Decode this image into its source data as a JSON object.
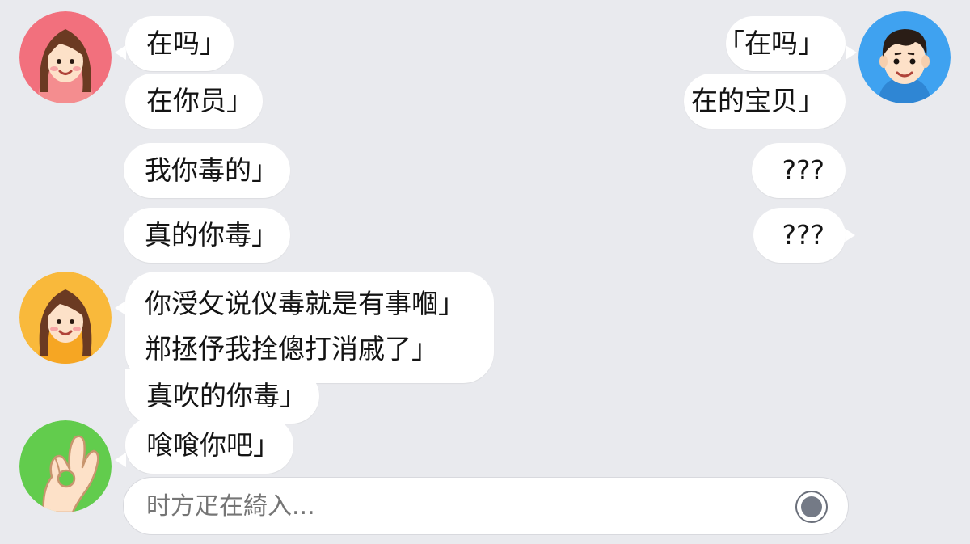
{
  "conversation": {
    "left_top_messages": [
      {
        "text": "在吗」"
      },
      {
        "text": "在你员」"
      },
      {
        "text": "我你毒的」"
      },
      {
        "text": "真的你毒」"
      }
    ],
    "right_messages": [
      {
        "text": "「在吗」"
      },
      {
        "text": "在的宝贝」"
      },
      {
        "text": "???"
      },
      {
        "text": "???"
      }
    ],
    "left_bottom_block": {
      "lines": [
        "你涭攵说仪毒就是有事嗰」",
        "郱拯伃我拴傯打消戚了」",
        "真吹的你毒」"
      ]
    },
    "left_last_message": {
      "text": "喰喰你吧」"
    }
  },
  "avatars": {
    "left_top": {
      "icon": "girl-avatar-icon",
      "bg": "#f2707d"
    },
    "left_middle": {
      "icon": "girl-avatar-icon",
      "bg": "#f9b93b"
    },
    "left_bottom": {
      "icon": "ok-hand-icon",
      "bg": "#62cc4d"
    },
    "right_top": {
      "icon": "boy-avatar-icon",
      "bg": "#3fa2f0"
    }
  },
  "input": {
    "placeholder": "时方疋在綺入..."
  },
  "colors": {
    "background": "#e9eaee",
    "bubble": "#ffffff"
  }
}
